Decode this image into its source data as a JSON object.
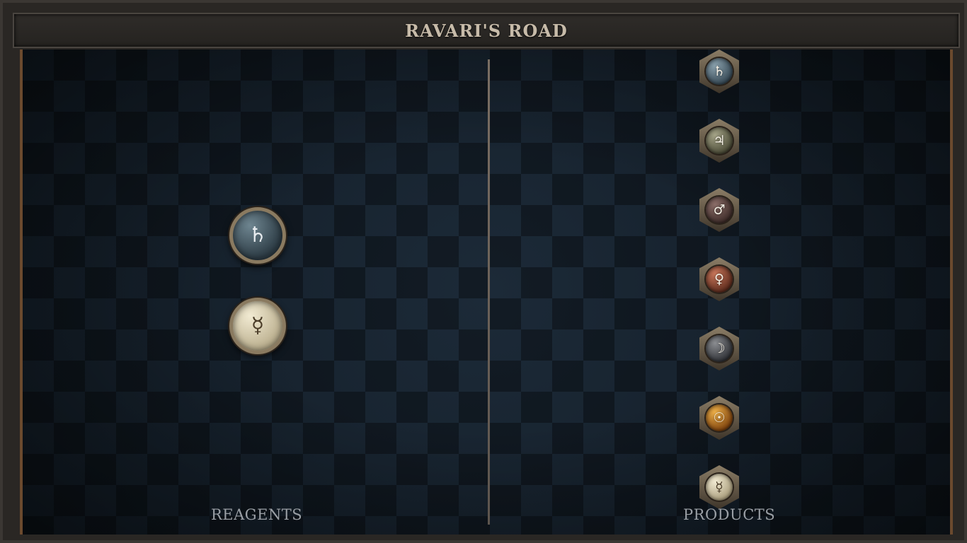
{
  "title": "RAVARI'S ROAD",
  "sections": {
    "reagents_label": "REAGENTS",
    "products_label": "PRODUCTS"
  },
  "reagents": [
    {
      "symbol": "♄",
      "icon": "saturn-icon"
    },
    {
      "symbol": "☿",
      "icon": "mercury-icon"
    }
  ],
  "products": [
    {
      "symbol": "♄",
      "icon": "saturn-icon"
    },
    {
      "symbol": "♃",
      "icon": "jupiter-icon"
    },
    {
      "symbol": "♂",
      "icon": "mars-icon"
    },
    {
      "symbol": "♀",
      "icon": "venus-icon"
    },
    {
      "symbol": "☽",
      "icon": "moon-icon"
    },
    {
      "symbol": "☉",
      "icon": "sun-icon"
    },
    {
      "symbol": "☿",
      "icon": "mercury-icon"
    }
  ],
  "colors": {
    "frame": "#2a2724",
    "board": "#15202b",
    "accent_copper": "#6b4a2e",
    "title_text": "#c7bba9",
    "label_text": "#9a9fa5"
  }
}
